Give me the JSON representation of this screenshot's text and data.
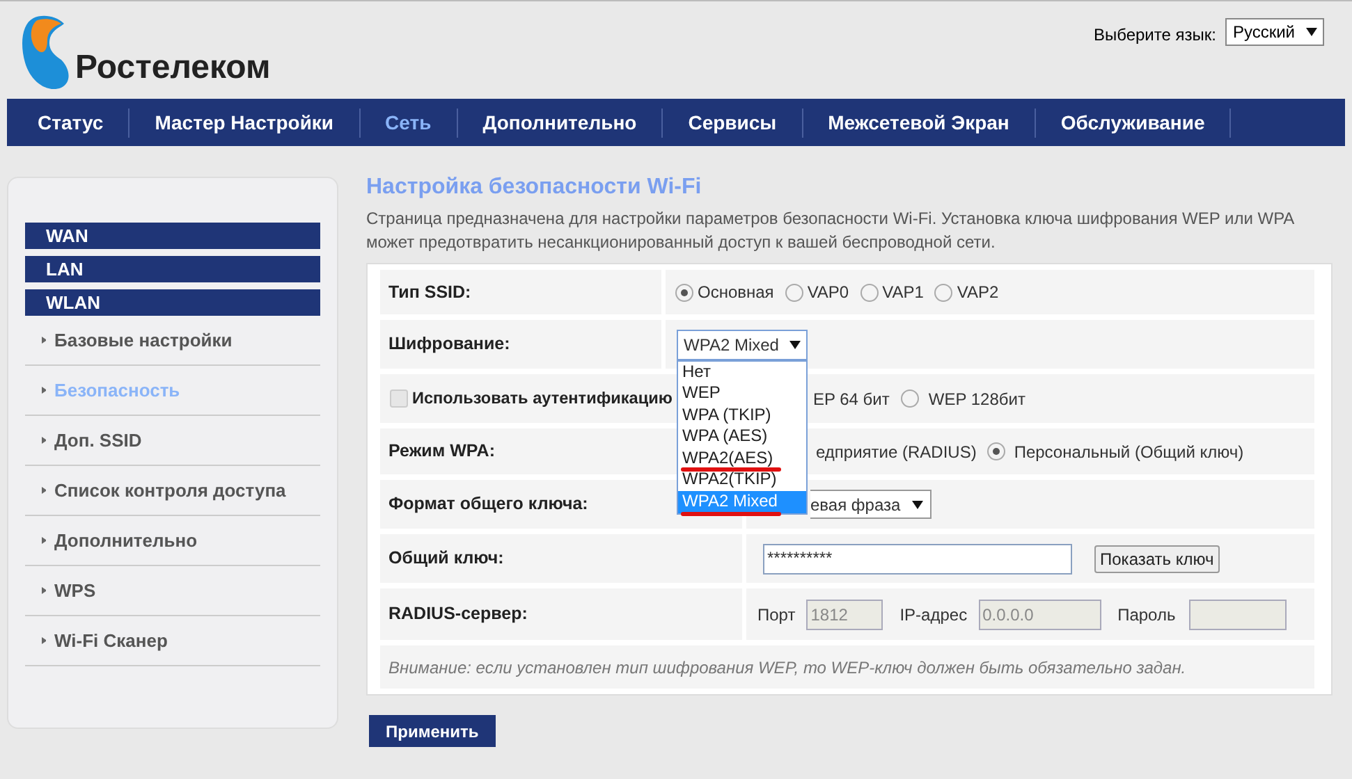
{
  "header": {
    "brand": "Ростелеком",
    "language_label": "Выберите язык:",
    "language": "Русский"
  },
  "nav": [
    {
      "label": "Статус",
      "selected": false
    },
    {
      "label": "Мастер Настройки",
      "selected": false
    },
    {
      "label": "Сеть",
      "selected": true
    },
    {
      "label": "Дополнительно",
      "selected": false
    },
    {
      "label": "Сервисы",
      "selected": false
    },
    {
      "label": "Межсетевой Экран",
      "selected": false
    },
    {
      "label": "Обслуживание",
      "selected": false
    }
  ],
  "sidebar": {
    "groups": [
      {
        "label": "WAN"
      },
      {
        "label": "LAN"
      },
      {
        "label": "WLAN",
        "children": [
          {
            "label": "Базовые настройки",
            "selected": false
          },
          {
            "label": "Безопасность",
            "selected": true
          },
          {
            "label": "Доп. SSID",
            "selected": false
          },
          {
            "label": "Список контроля доступа",
            "selected": false
          },
          {
            "label": "Дополнительно",
            "selected": false
          },
          {
            "label": "WPS",
            "selected": false
          },
          {
            "label": "Wi-Fi Сканер",
            "selected": false
          }
        ]
      }
    ]
  },
  "page": {
    "title": "Настройка безопасности Wi-Fi",
    "description": "Страница предназначена для настройки параметров безопасности Wi-Fi. Установка ключа шифрования WEP или WPA может предотвратить несанкционированный доступ к вашей беспроводной сети."
  },
  "form": {
    "ssid_type": {
      "label": "Тип SSID:",
      "options": [
        {
          "label": "Основная",
          "selected": true
        },
        {
          "label": "VAP0",
          "selected": false
        },
        {
          "label": "VAP1",
          "selected": false
        },
        {
          "label": "VAP2",
          "selected": false
        }
      ]
    },
    "encryption": {
      "label": "Шифрование:",
      "value": "WPA2 Mixed",
      "expanded": true,
      "options": [
        {
          "label": "Нет",
          "highlighted": false,
          "underlined": false
        },
        {
          "label": "WEP",
          "highlighted": false,
          "underlined": false
        },
        {
          "label": "WPA (TKIP)",
          "highlighted": false,
          "underlined": false
        },
        {
          "label": "WPA (AES)",
          "highlighted": false,
          "underlined": false
        },
        {
          "label": "WPA2(AES)",
          "highlighted": false,
          "underlined": true
        },
        {
          "label": "WPA2(TKIP)",
          "highlighted": false,
          "underlined": false
        },
        {
          "label": "WPA2 Mixed",
          "highlighted": true,
          "underlined": true
        }
      ]
    },
    "auth": {
      "label": "Использовать аутентификацию",
      "checked": false,
      "options": [
        {
          "label": "EP 64 бит"
        },
        {
          "label": "WEP 128бит",
          "selected": false
        }
      ]
    },
    "wpa_mode": {
      "label": "Режим WPA:",
      "options": [
        {
          "label": "едприятие (RADIUS)"
        },
        {
          "label": "Персональный (Общий ключ)",
          "selected": true
        }
      ]
    },
    "key_format": {
      "label": "Формат общего ключа:",
      "value": "евая фраза"
    },
    "key": {
      "label": "Общий ключ:",
      "value": "**********",
      "button": "Показать ключ"
    },
    "radius": {
      "label": "RADIUS-сервер:",
      "port_label": "Порт",
      "port": "1812",
      "ip_label": "IP-адрес",
      "ip": "0.0.0.0",
      "password_label": "Пароль"
    },
    "note": "Внимание: если установлен тип шифрования WEP, то WEP-ключ должен быть обязательно задан."
  },
  "apply_button": "Применить"
}
